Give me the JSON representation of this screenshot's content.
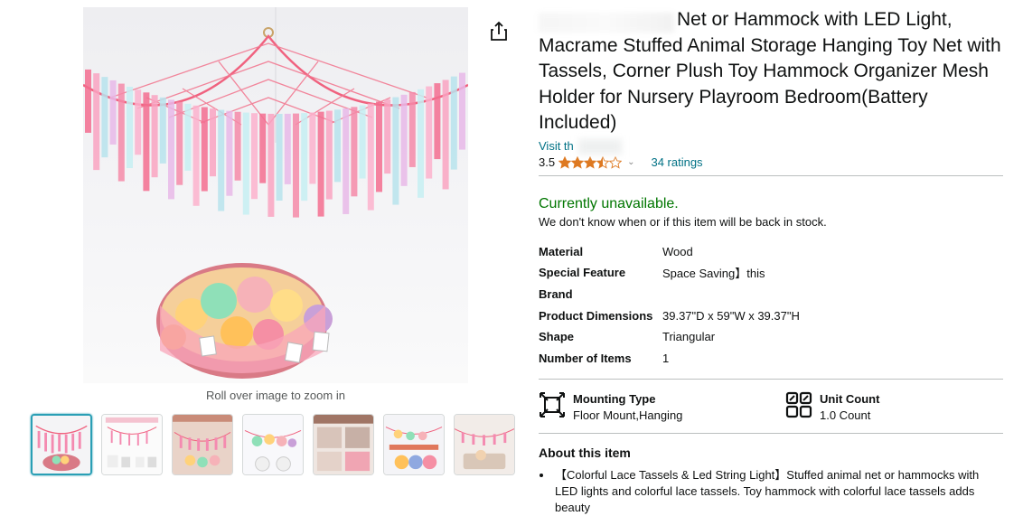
{
  "product": {
    "title": "Net or Hammock with LED Light, Macrame Stuffed Animal Storage Hanging Toy Net with Tassels, Corner Plush Toy Hammock Organizer Mesh Holder for Nursery Playroom Bedroom(Battery Included)",
    "store_link": "Visit th",
    "rating_value": "3.5",
    "rating_stars": 3.5,
    "ratings_count": "34 ratings",
    "availability": "Currently unavailable.",
    "restock_note": "We don't know when or if this item will be back in stock."
  },
  "image": {
    "zoom_hint": "Roll over image to zoom in",
    "thumbnail_count": 7
  },
  "specs": [
    {
      "label": "Material",
      "value": "Wood"
    },
    {
      "label": "Special Feature",
      "value": "Space Saving】this"
    },
    {
      "label": "Brand",
      "value": ""
    },
    {
      "label": "Product Dimensions",
      "value": "39.37\"D x 59\"W x 39.37\"H"
    },
    {
      "label": "Shape",
      "value": "Triangular"
    },
    {
      "label": "Number of Items",
      "value": "1"
    }
  ],
  "features": {
    "mounting": {
      "label": "Mounting Type",
      "value": "Floor Mount,Hanging",
      "icon": "mounting-icon"
    },
    "unit_count": {
      "label": "Unit Count",
      "value": "1.0 Count",
      "icon": "unit-count-icon"
    }
  },
  "about": {
    "heading": "About this item",
    "bullets": [
      "【Colorful Lace Tassels & Led String Light】Stuffed animal net or hammocks with LED lights and colorful lace tassels. Toy hammock with colorful lace tassels adds beauty"
    ]
  },
  "colors": {
    "link": "#007185",
    "available_green": "#007600",
    "star": "#de7921",
    "thumb_active": "#2a9fb5"
  }
}
